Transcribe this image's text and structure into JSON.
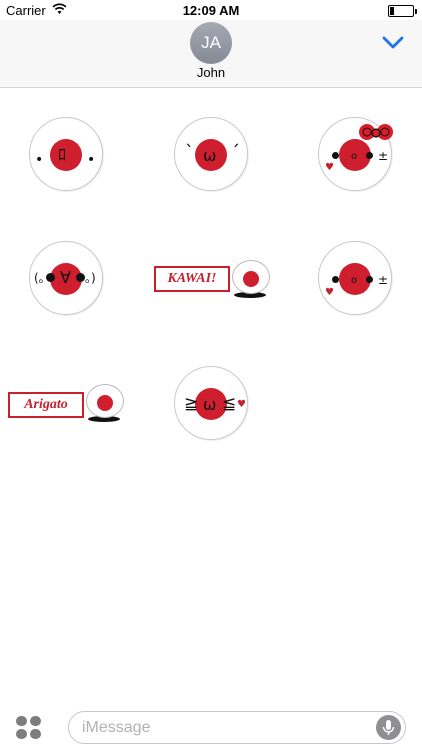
{
  "status_bar": {
    "carrier": "Carrier",
    "time": "12:09 AM",
    "battery_level": 0.2
  },
  "header": {
    "avatar_initials": "JA",
    "contact_name": "John"
  },
  "stickers": {
    "kawai_label": "KAWAI!",
    "arigato_label": "Arigato",
    "face_1": {
      "left": "•",
      "mouth": "ﾛ",
      "right": "•"
    },
    "face_2": {
      "brow_left": "ˋ",
      "mouth": "ω",
      "brow_right": "ˊ"
    },
    "face_3": {
      "eyes": "•",
      "mouth": "ο",
      "pm": "±"
    },
    "face_4": {
      "left": "(｡",
      "mouth": "∀",
      "right": "｡)"
    },
    "face_5": {
      "mouth": "ο",
      "pm": "±"
    },
    "face_6": {
      "left": "≧",
      "mouth": "ω",
      "right": "≦"
    }
  },
  "input": {
    "placeholder": "iMessage"
  },
  "colors": {
    "accent": "#1a73e8",
    "sticker_red": "#cf1f2e"
  },
  "icons": [
    "wifi-icon",
    "battery-icon",
    "chevron-down-icon",
    "app-drawer-icon",
    "microphone-icon",
    "heart-icon",
    "bow-icon"
  ]
}
